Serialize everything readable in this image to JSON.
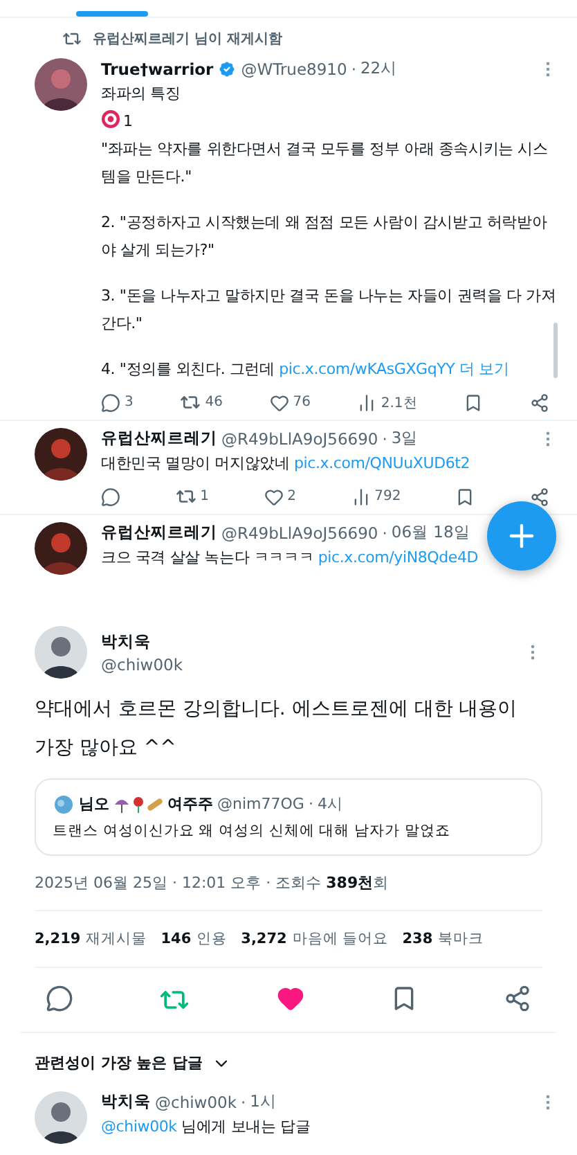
{
  "retweet_notice": "유럽산찌르레기 님이 재게시함",
  "feed": [
    {
      "name": "True†warrior",
      "verified": true,
      "handle": "@WTrue8910",
      "separator": "·",
      "time": "22시",
      "paragraphs": [
        {
          "lines": [
            {
              "kind": "text",
              "text": "좌파의 특징"
            },
            {
              "kind": "target",
              "text": "1"
            },
            {
              "kind": "text",
              "text": "\"좌파는 약자를 위한다면서 결국 모두를 정부 아래 종속시키는 시스템을 만든다.\""
            }
          ]
        },
        {
          "lines": [
            {
              "kind": "text",
              "text": "2. \"공정하자고 시작했는데 왜 점점 모든 사람이 감시받고 허락받아야 살게 되는가?\""
            }
          ]
        },
        {
          "lines": [
            {
              "kind": "text",
              "text": "3. \"돈을 나누자고 말하지만 결국 돈을 나누는 자들이 권력을 다 가져간다.\""
            }
          ]
        },
        {
          "lines": [
            {
              "kind": "text",
              "text": "4. \"정의를 외친다. 그런데 ",
              "link": "pic.x.com/wKAsGXGqYY",
              "more": "더 보기"
            }
          ]
        }
      ],
      "stats": {
        "replies": "3",
        "reposts": "46",
        "likes": "76",
        "views": "2.1천"
      }
    },
    {
      "name": "유럽산찌르레기",
      "handle": "@R49bLlA9oJ56690",
      "separator": "·",
      "time": "3일",
      "paragraphs": [
        {
          "lines": [
            {
              "kind": "text",
              "text": "대한민국 멸망이 머지않았네 ",
              "link": "pic.x.com/QNUuXUD6t2"
            }
          ]
        }
      ],
      "stats": {
        "reposts": "1",
        "likes": "2",
        "views": "792"
      }
    },
    {
      "name": "유럽산찌르레기",
      "handle": "@R49bLlA9oJ56690",
      "separator": "·",
      "time": "06월 18일",
      "paragraphs": [
        {
          "lines": [
            {
              "kind": "text",
              "text": "크으 국격 살살 녹는다 ㅋㅋㅋㅋ ",
              "link": "pic.x.com/yiN8Qde4D"
            }
          ]
        }
      ]
    }
  ],
  "main": {
    "name": "박치욱",
    "handle": "@chiw00k",
    "text": "약대에서 호르몬 강의합니다. 에스트로젠에 대한 내용이 가장 많아요 ^^",
    "quote": {
      "name_start": "님오",
      "name_end": "여주주",
      "handle": "@nim77OG",
      "separator": "·",
      "time": "4시",
      "text": "트랜스 여성이신가요 왜 여성의 신체에 대해 남자가 말얹죠"
    },
    "meta": "2025년 06월 25일 · 12:01 오후 · 조회수 **389천**회",
    "stats": [
      {
        "count": "2,219",
        "label": "재게시물"
      },
      {
        "count": "146",
        "label": "인용"
      },
      {
        "count": "3,272",
        "label": "마음에 들어요"
      },
      {
        "count": "238",
        "label": "북마크"
      }
    ],
    "reposted": true,
    "liked": true,
    "bookmarked": false
  },
  "sort_label": "관련성이 가장 높은 답글",
  "reply": {
    "name": "박치욱",
    "handle": "@chiw00k",
    "separator": "·",
    "time": "1시",
    "mention": "@chiw00k",
    "rest": " 님에게 보내는 답글"
  }
}
